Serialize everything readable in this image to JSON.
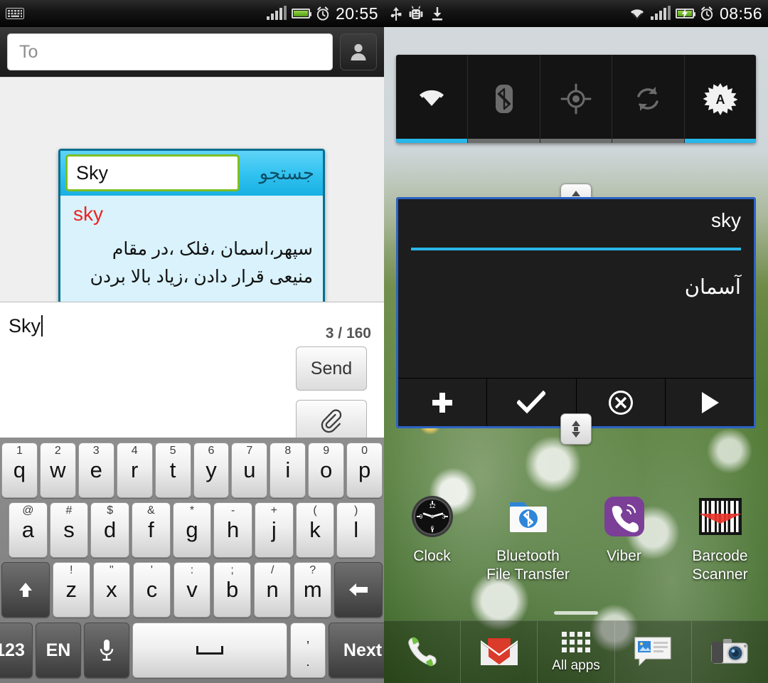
{
  "left_screen": {
    "statusbar": {
      "time": "20:55",
      "icons": [
        "keyboard-icon",
        "signal-bars-icon",
        "battery-icon",
        "alarm-clock-icon"
      ]
    },
    "compose": {
      "to_placeholder": "To",
      "contact_picker_icon": "contact-avatar-icon",
      "message_text": "Sky",
      "counter": "3 / 160",
      "send_label": "Send",
      "attach_icon": "paperclip-icon"
    },
    "dictionary_popup": {
      "query_value": "Sky",
      "search_button_label": "جستجو",
      "headword": "sky",
      "definition": "سپهر،اسمان ،فلک ،در مقام منیعی قرار دادن ،زیاد بالا بردن",
      "accent_border": "#0a6f91",
      "input_border": "#7cc023",
      "panel_bg": "#d9f2fb",
      "headword_color": "#ee2222"
    },
    "keyboard": {
      "row1": [
        {
          "alt": "1",
          "key": "q"
        },
        {
          "alt": "2",
          "key": "w"
        },
        {
          "alt": "3",
          "key": "e"
        },
        {
          "alt": "4",
          "key": "r"
        },
        {
          "alt": "5",
          "key": "t"
        },
        {
          "alt": "6",
          "key": "y"
        },
        {
          "alt": "7",
          "key": "u"
        },
        {
          "alt": "8",
          "key": "i"
        },
        {
          "alt": "9",
          "key": "o"
        },
        {
          "alt": "0",
          "key": "p"
        }
      ],
      "row2": [
        {
          "alt": "@",
          "key": "a"
        },
        {
          "alt": "#",
          "key": "s"
        },
        {
          "alt": "$",
          "key": "d"
        },
        {
          "alt": "&",
          "key": "f"
        },
        {
          "alt": "*",
          "key": "g"
        },
        {
          "alt": "-",
          "key": "h"
        },
        {
          "alt": "+",
          "key": "j"
        },
        {
          "alt": "(",
          "key": "k"
        },
        {
          "alt": ")",
          "key": "l"
        }
      ],
      "row3": [
        {
          "alt": "!",
          "key": "z"
        },
        {
          "alt": "\"",
          "key": "x"
        },
        {
          "alt": "'",
          "key": "c"
        },
        {
          "alt": ":",
          "key": "v"
        },
        {
          "alt": ";",
          "key": "b"
        },
        {
          "alt": "/",
          "key": "n"
        },
        {
          "alt": "?",
          "key": "m"
        }
      ],
      "shift_icon": "shift-up-arrow-icon",
      "backspace_icon": "backspace-arrow-icon",
      "num_label": "123",
      "lang_label": "EN",
      "mic_icon": "microphone-icon",
      "space_icon": "spacebar-icon",
      "punct_top": ",",
      "punct_bottom": ".",
      "next_label": "Next"
    }
  },
  "right_screen": {
    "statusbar": {
      "time": "08:56",
      "icons": [
        "usb-icon",
        "android-debug-icon",
        "download-icon",
        "wifi-icon",
        "signal-bars-icon",
        "battery-charging-icon",
        "alarm-clock-icon"
      ]
    },
    "quick_settings": [
      {
        "name": "wifi-toggle",
        "icon": "wifi-icon",
        "state": "on"
      },
      {
        "name": "bluetooth-toggle",
        "icon": "bluetooth-icon",
        "state": "off"
      },
      {
        "name": "gps-toggle",
        "icon": "gps-icon",
        "state": "off"
      },
      {
        "name": "sync-toggle",
        "icon": "sync-icon",
        "state": "off"
      },
      {
        "name": "auto-brightness-toggle",
        "icon": "brightness-auto-icon",
        "state": "on"
      }
    ],
    "translate_widget": {
      "source_text": "sky",
      "target_text": "آسمان",
      "divider_color": "#29b6e8",
      "selection_border": "#2c63c4",
      "actions": [
        {
          "name": "add-button",
          "icon": "plus-icon"
        },
        {
          "name": "confirm-button",
          "icon": "check-icon"
        },
        {
          "name": "clear-button",
          "icon": "circle-x-icon"
        },
        {
          "name": "play-button",
          "icon": "play-triangle-icon"
        }
      ],
      "resize_handle_icon": "vertical-resize-icon"
    },
    "apps": [
      {
        "label": "Clock",
        "icon": "analog-clock-icon"
      },
      {
        "label": "Bluetooth File Transfer",
        "icon": "bluetooth-folder-icon"
      },
      {
        "label": "Viber",
        "icon": "viber-phone-icon"
      },
      {
        "label": "Barcode Scanner",
        "icon": "barcode-icon"
      }
    ],
    "dock": [
      {
        "label": "",
        "icon": "phone-icon",
        "name": "dock-phone"
      },
      {
        "label": "",
        "icon": "gmail-icon",
        "name": "dock-gmail"
      },
      {
        "label": "All apps",
        "icon": "app-grid-icon",
        "name": "dock-all-apps"
      },
      {
        "label": "",
        "icon": "messaging-icon",
        "name": "dock-messaging"
      },
      {
        "label": "",
        "icon": "camera-icon",
        "name": "dock-camera"
      }
    ]
  }
}
